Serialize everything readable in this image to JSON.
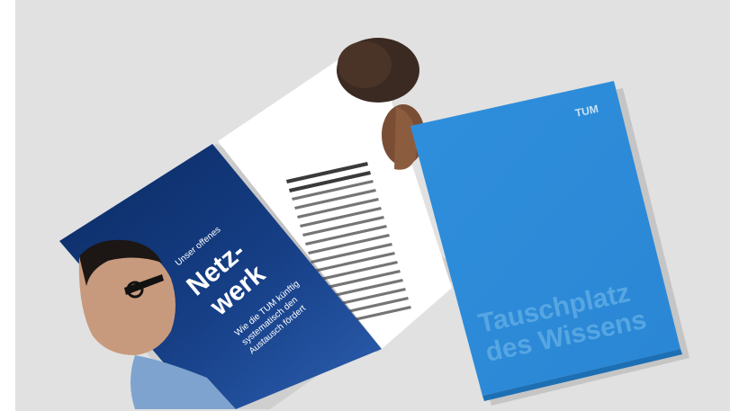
{
  "brochure": {
    "spread": {
      "kicker": "Unser offenes",
      "headline_line1": "Netz-",
      "headline_line2": "werk",
      "subline_line1": "Wie die TUM künftig",
      "subline_line2": "systematisch den",
      "subline_line3": "Austausch fördert"
    },
    "cover": {
      "logo": "TUM",
      "title_line1": "Tauschplatz",
      "title_line2": "des Wissens"
    }
  },
  "colors": {
    "background": "#e1e1e1",
    "spread_blue_dark": "#0b2a63",
    "spread_blue_light": "#2d5fb0",
    "cover_blue": "#2f8fdc",
    "cover_title": "#56a6e2"
  }
}
